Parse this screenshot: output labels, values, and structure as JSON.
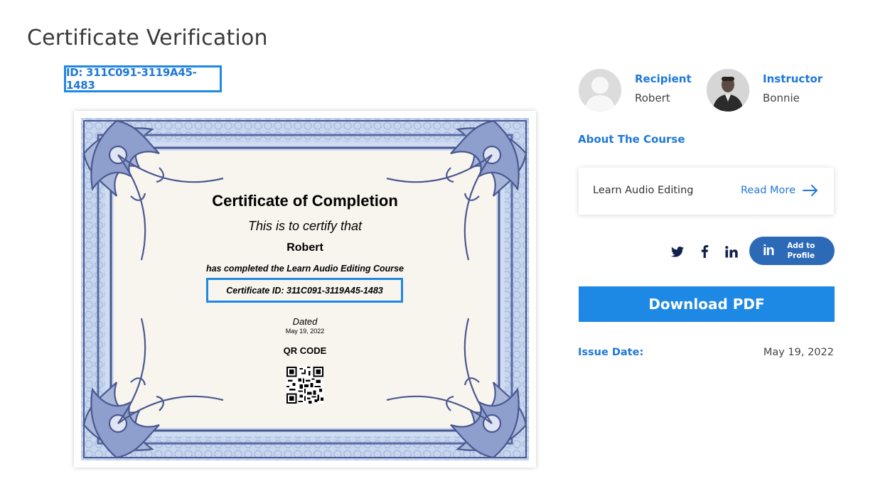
{
  "page": {
    "title": "Certificate Verification"
  },
  "certificate": {
    "id_label": "ID: 311C091-3119A45-1483",
    "title": "Certificate of Completion",
    "certify_line": "This is to certify that",
    "recipient_name": "Robert",
    "completed_line": "has completed the Learn Audio Editing Course",
    "certificate_id_line": "Certificate ID: 311C091-3119A45-1483",
    "dated_label": "Dated",
    "date": "May 19, 2022",
    "qr_label": "QR CODE"
  },
  "people": {
    "recipient": {
      "label": "Recipient",
      "name": "Robert"
    },
    "instructor": {
      "label": "Instructor",
      "name": "Bonnie"
    }
  },
  "course": {
    "about_label": "About The Course",
    "name": "Learn Audio Editing",
    "read_more": "Read More"
  },
  "share": {
    "icons": [
      "twitter-icon",
      "facebook-icon",
      "linkedin-icon"
    ],
    "add_profile_logo": "in",
    "add_profile_label": "Add to Profile"
  },
  "actions": {
    "download": "Download PDF"
  },
  "issue": {
    "label": "Issue Date:",
    "value": "May 19, 2022"
  },
  "colors": {
    "accent": "#1e88e5",
    "link": "#1e78d8",
    "linkedin": "#2c6ab8",
    "frame": "#5a6aa6"
  }
}
